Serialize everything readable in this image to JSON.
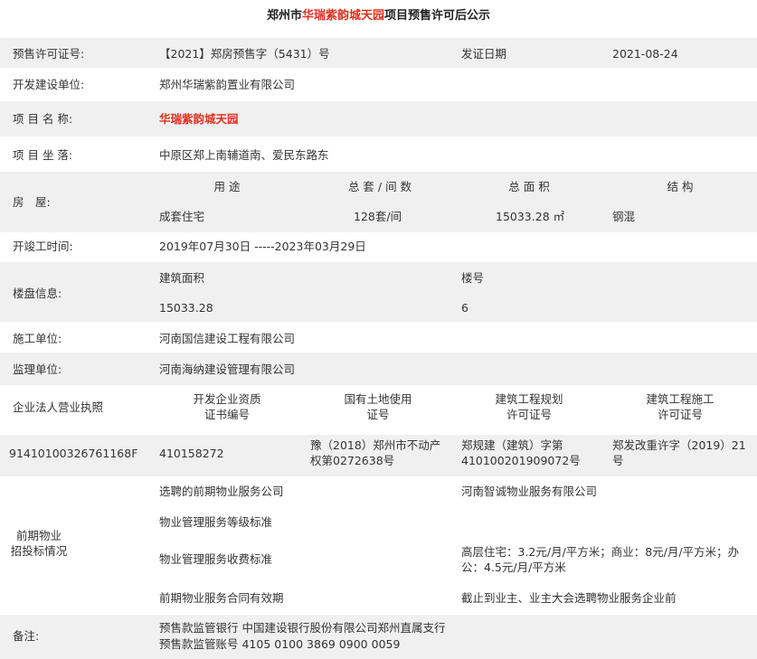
{
  "title": {
    "prefix": "郑州市",
    "project": "华瑞紫韵城天园",
    "suffix": "项目预售许可后公示"
  },
  "permit": {
    "label": "预售许可证号:",
    "value": "【2021】郑房预售字（5431）号",
    "date_label": "发证日期",
    "date_value": "2021-08-24"
  },
  "developer": {
    "label": "开发建设单位:",
    "value": "郑州华瑞紫韵置业有限公司"
  },
  "project_name": {
    "label": "项 目 名 称:",
    "value": "华瑞紫韵城天园"
  },
  "location": {
    "label": "项 目 坐 落:",
    "value": "中原区郑上南辅道南、爱民东路东"
  },
  "housing": {
    "label": "房　屋:",
    "headers": [
      "用 途",
      "总 套 / 间 数",
      "总 面 积",
      "结 构"
    ],
    "values": [
      "成套住宅",
      "128套/间",
      "15033.28 ㎡",
      "钢混"
    ]
  },
  "schedule": {
    "label": "开竣工时间:",
    "value": "2019年07月30日 -----2023年03月29日"
  },
  "building": {
    "label": "楼盘信息:",
    "area_label": "建筑面积",
    "area_value": "15033.28",
    "no_label": "楼号",
    "no_value": "6"
  },
  "constructor": {
    "label": "施工单位:",
    "value": "河南国信建设工程有限公司"
  },
  "supervisor": {
    "label": "监理单位:",
    "value": "河南海纳建设管理有限公司"
  },
  "licenses": {
    "headers": [
      "企业法人营业执照",
      "开发企业资质\n证书编号",
      "国有土地使用\n证号",
      "建筑工程规划\n许可证号",
      "建筑工程施工\n许可证号"
    ],
    "values": [
      "91410100326761168F",
      "410158272",
      "豫（2018）郑州市不动产权第0272638号",
      "郑规建（建筑）字第410100201909072号",
      "郑发改重许字（2019）21号"
    ]
  },
  "property": {
    "label": "前期物业\n招投标情况",
    "rows": [
      {
        "key": "选聘的前期物业服务公司",
        "value": "河南智诚物业服务有限公司"
      },
      {
        "key": "物业管理服务等级标准",
        "value": ""
      },
      {
        "key": "物业管理服务收费标准",
        "value": "高层住宅：3.2元/月/平方米；商业：8元/月/平方米；办公：4.5元/月/平方米"
      },
      {
        "key": "前期物业服务合同有效期",
        "value": "截止到业主、业主大会选聘物业服务企业前"
      }
    ]
  },
  "remarks": {
    "label": "备注:",
    "line1": "预售款监管银行 中国建设银行股份有限公司郑州直属支行",
    "line2": "预售款监管账号 4105 0100 3869 0900 0059"
  }
}
